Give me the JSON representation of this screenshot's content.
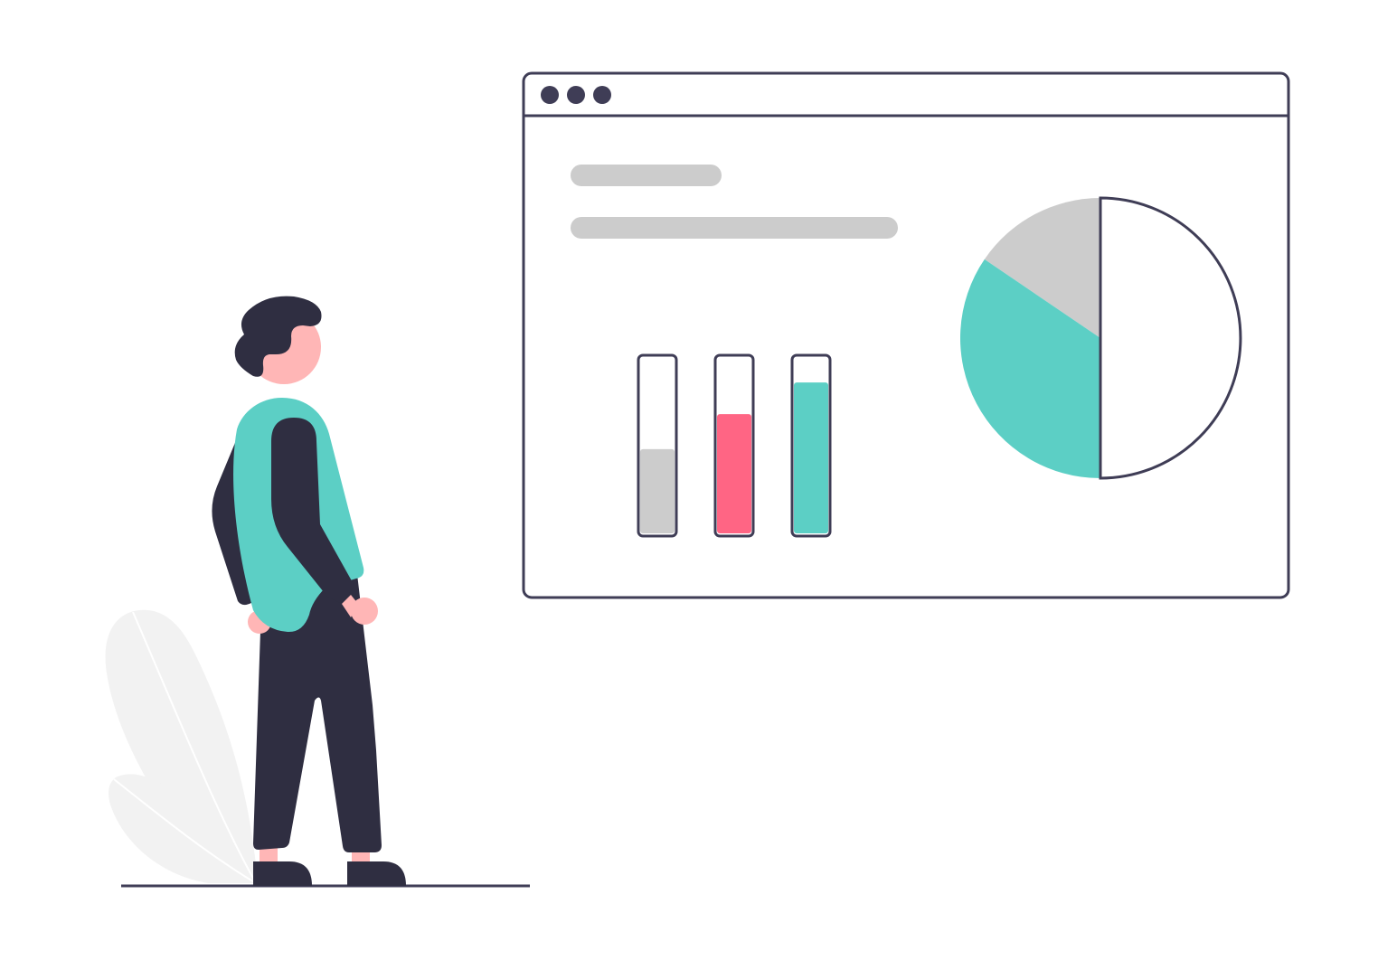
{
  "colors": {
    "outline": "#3f3d56",
    "dark": "#2f2e41",
    "placeholder": "#cccccc",
    "teal": "#5ccfc5",
    "pink": "#ff6584",
    "skin": "#ffb6b6",
    "plant": "#f2f2f2",
    "background": "#ffffff"
  },
  "window": {
    "dots": [
      "dot",
      "dot",
      "dot"
    ],
    "text_placeholders": [
      "short-line",
      "long-line"
    ]
  },
  "bar_gauges": [
    {
      "level": 0.48,
      "color": "#cccccc"
    },
    {
      "level": 0.68,
      "color": "#ff6584"
    },
    {
      "level": 0.86,
      "color": "#5ccfc5"
    }
  ],
  "pie": {
    "slices": [
      {
        "fraction": 0.155,
        "color": "#cccccc"
      },
      {
        "fraction": 0.345,
        "color": "#5ccfc5"
      },
      {
        "fraction": 0.5,
        "color": "#ffffff"
      }
    ]
  }
}
